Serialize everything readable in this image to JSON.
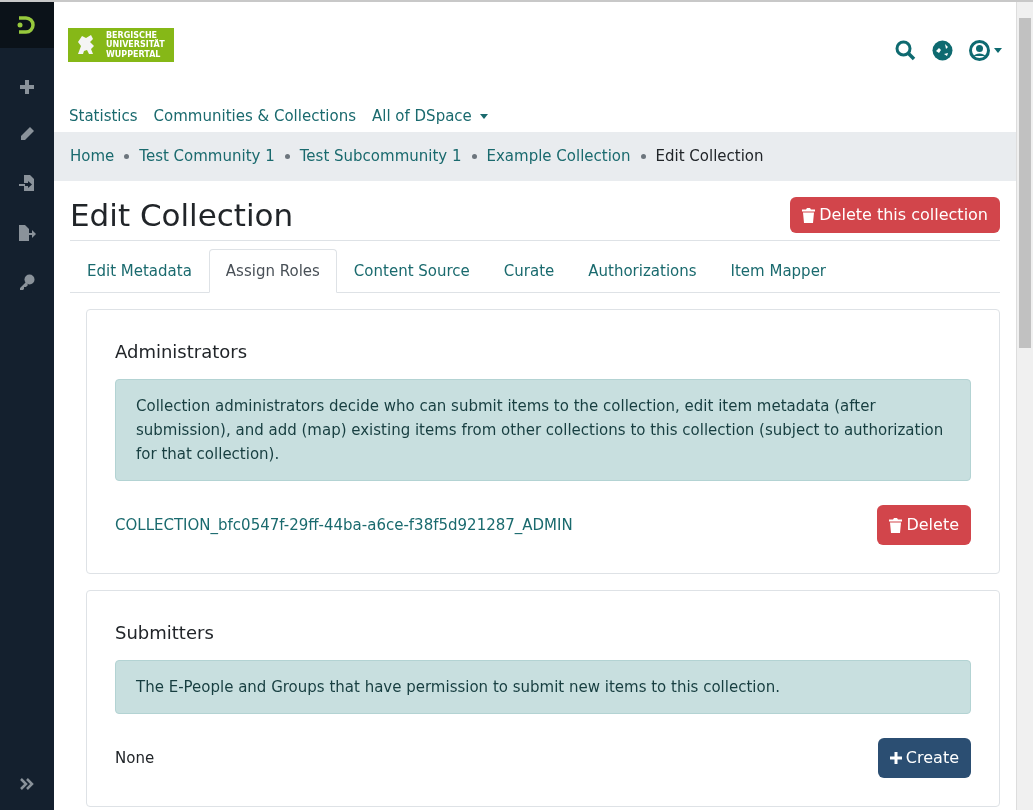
{
  "logo": {
    "lines": [
      "BERGISCHE",
      "UNIVERSITÄT",
      "WUPPERTAL"
    ]
  },
  "nav": [
    {
      "label": "Statistics",
      "dropdown": false
    },
    {
      "label": "Communities & Collections",
      "dropdown": false
    },
    {
      "label": "All of DSpace",
      "dropdown": true
    }
  ],
  "breadcrumb": [
    {
      "label": "Home",
      "current": false
    },
    {
      "label": "Test Community 1",
      "current": false
    },
    {
      "label": "Test Subcommunity 1",
      "current": false
    },
    {
      "label": "Example Collection",
      "current": false
    },
    {
      "label": "Edit Collection",
      "current": true
    }
  ],
  "title": "Edit Collection",
  "delete_button": "Delete this collection",
  "tabs": [
    {
      "label": "Edit Metadata",
      "selected": false
    },
    {
      "label": "Assign Roles",
      "selected": true
    },
    {
      "label": "Content Source",
      "selected": false
    },
    {
      "label": "Curate",
      "selected": false
    },
    {
      "label": "Authorizations",
      "selected": false
    },
    {
      "label": "Item Mapper",
      "selected": false
    }
  ],
  "roles": [
    {
      "title": "Administrators",
      "info": "Collection administrators decide who can submit items to the collection, edit item metadata (after submission), and add (map) existing items from other collections to this collection (subject to authorization for that collection).",
      "group": "COLLECTION_bfc0547f-29ff-44ba-a6ce-f38f5d921287_ADMIN",
      "kind": "assigned",
      "action": "Delete"
    },
    {
      "title": "Submitters",
      "info": "The E-People and Groups that have permission to submit new items to this collection.",
      "group": "None",
      "kind": "empty",
      "action": "Create"
    }
  ]
}
